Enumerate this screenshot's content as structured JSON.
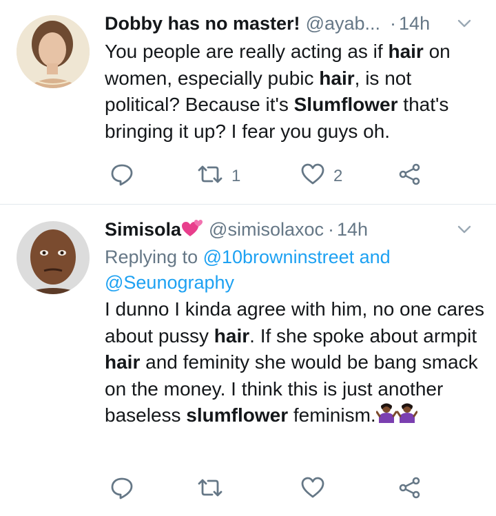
{
  "tweets": [
    {
      "name": "Dobby has no master!",
      "handle": "@ayab...",
      "time": "14h",
      "replying": null,
      "body": [
        {
          "t": "You people are really acting as if "
        },
        {
          "t": "hair",
          "b": true
        },
        {
          "t": " on women, especially pubic "
        },
        {
          "t": "hair",
          "b": true
        },
        {
          "t": ", is not political? Because it's "
        },
        {
          "t": "Slumflower",
          "b": true
        },
        {
          "t": " that's bringing it up? I fear you guys oh."
        }
      ],
      "retweets": "1",
      "likes": "2"
    },
    {
      "name": "Simisola",
      "name_emoji": "two-hearts-emoji",
      "handle": "@simisolaxoc",
      "time": "14h",
      "replying": {
        "prefix": "Replying to ",
        "mention1": "@10browninstreet",
        "and": " and",
        "mention2": "@Seunography"
      },
      "body": [
        {
          "t": "I dunno I kinda agree with him, no one cares about pussy "
        },
        {
          "t": "hair",
          "b": true
        },
        {
          "t": ". If she spoke about armpit "
        },
        {
          "t": "hair",
          "b": true
        },
        {
          "t": " and feminity she would be bang smack on the money. I think this is just another baseless "
        },
        {
          "t": "slumflower",
          "b": true
        },
        {
          "t": " feminism."
        }
      ],
      "body_emojis": [
        "person-shrugging-emoji",
        "person-shrugging-emoji"
      ],
      "retweets": "",
      "likes": ""
    }
  ],
  "colors": {
    "text": "#14171a",
    "secondary": "#657786",
    "link": "#1da1f2",
    "divider": "#e1e8ed"
  },
  "icons": [
    "reply-icon",
    "retweet-icon",
    "like-icon",
    "share-icon",
    "chevron-down-icon"
  ]
}
